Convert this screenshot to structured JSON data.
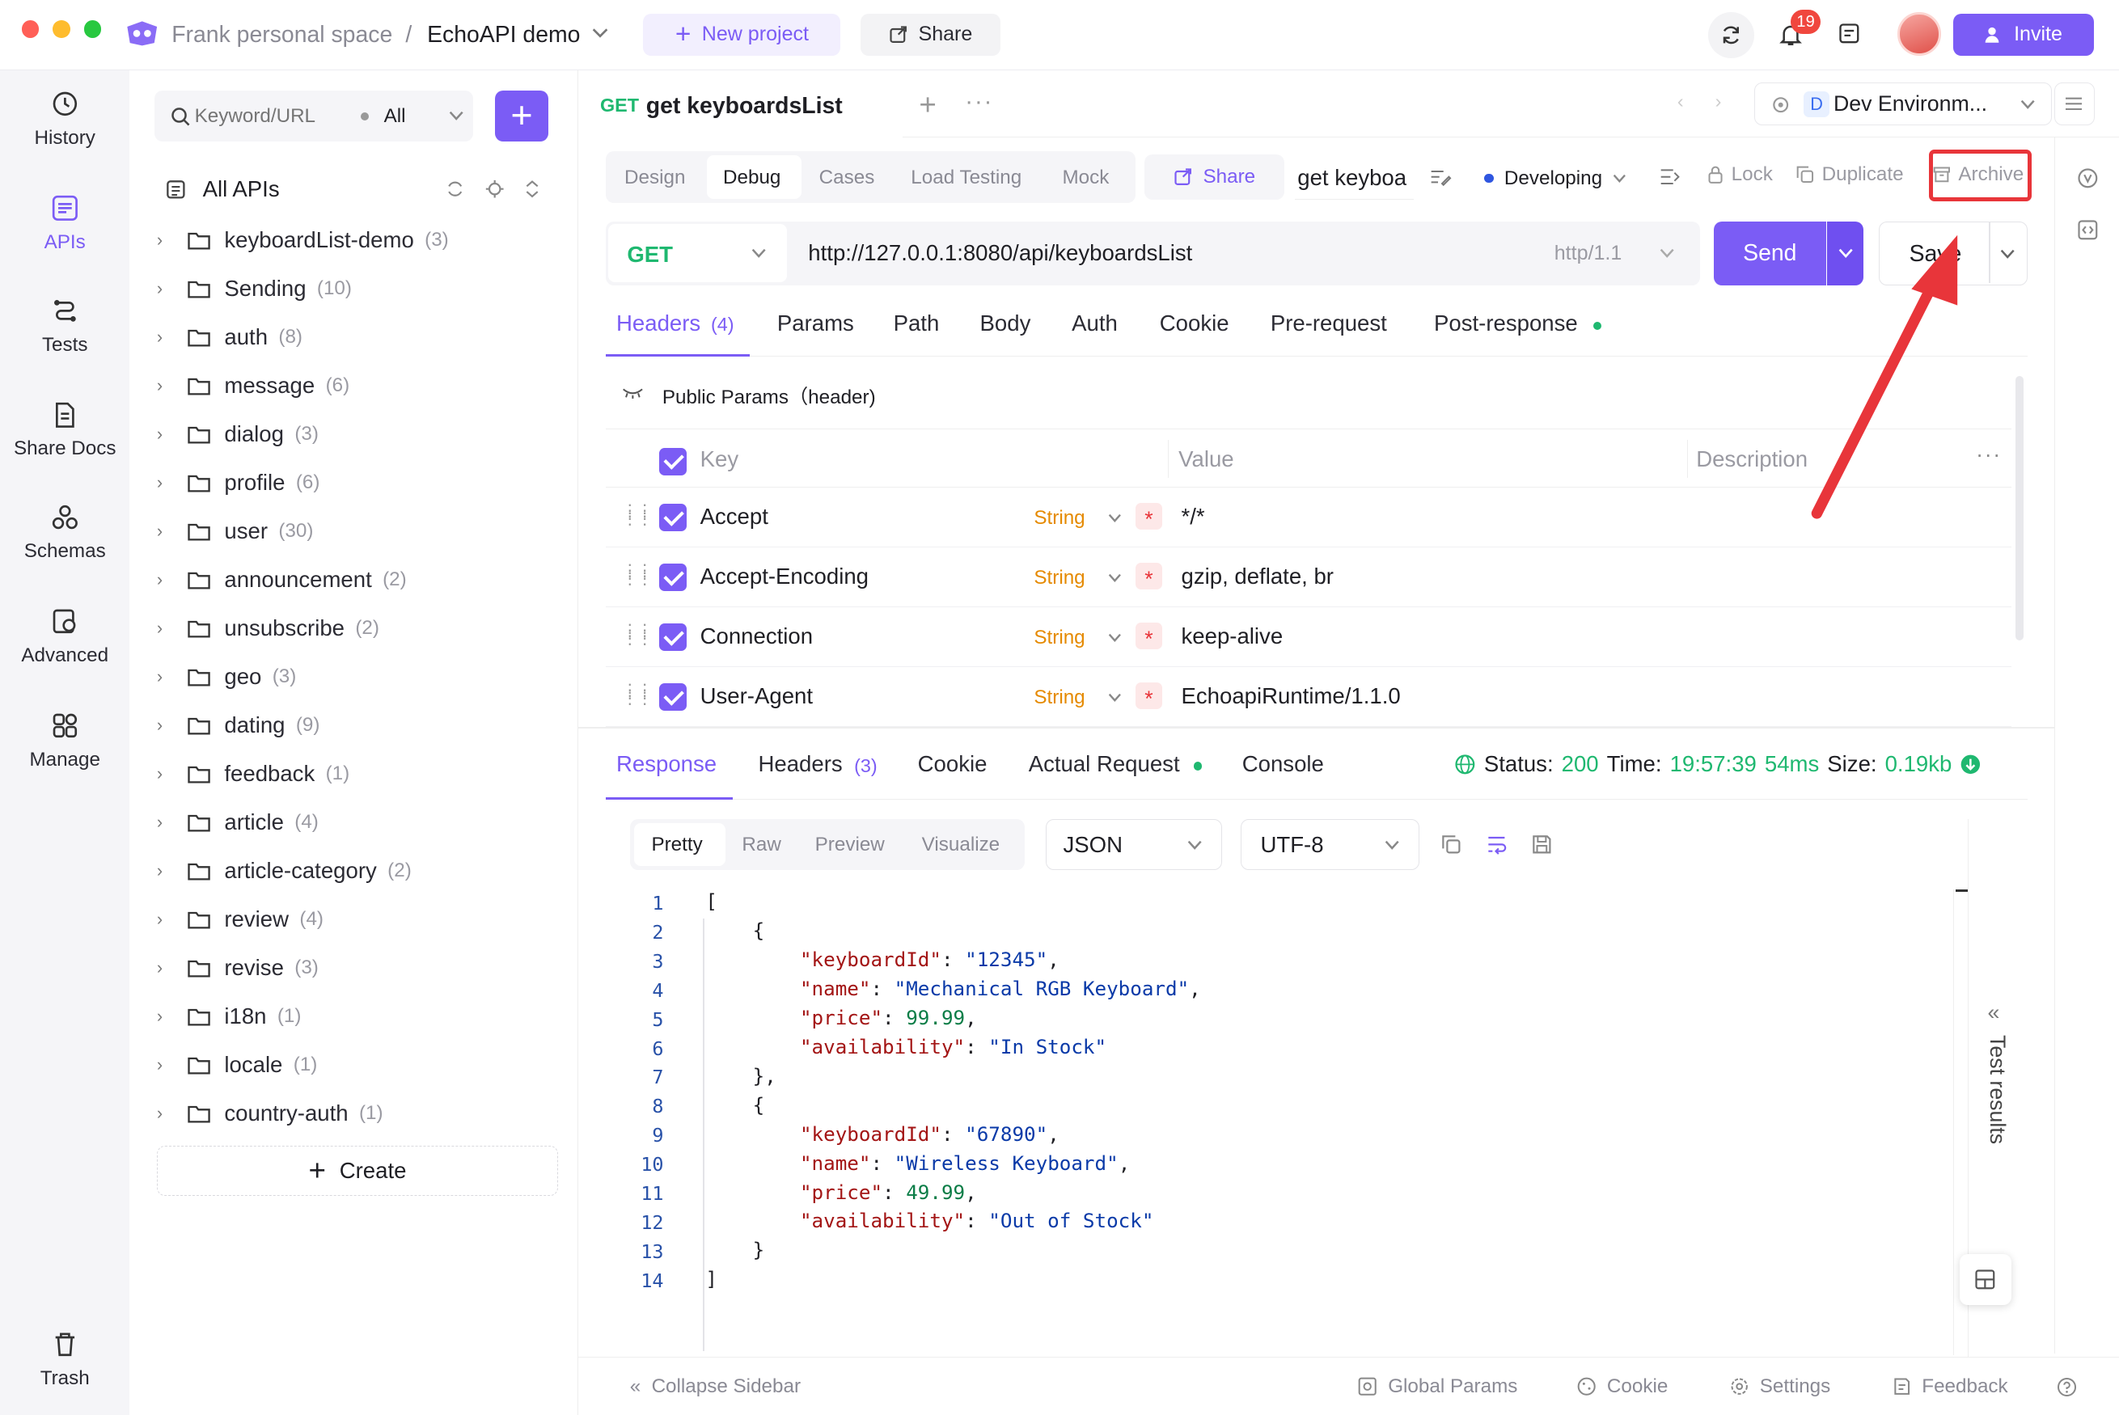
{
  "titlebar": {
    "workspace": "Frank personal space",
    "separator": "/",
    "project": "EchoAPI demo",
    "new_project": "New project",
    "share": "Share",
    "notif_count": "19",
    "invite": "Invite"
  },
  "rail": {
    "items": [
      "History",
      "APIs",
      "Tests",
      "Share Docs",
      "Schemas",
      "Advanced",
      "Manage"
    ],
    "trash": "Trash"
  },
  "tree": {
    "search_placeholder": "Keyword/URL",
    "filter": "All",
    "all_apis": "All APIs",
    "folders": [
      {
        "name": "keyboardList-demo",
        "count": "(3)"
      },
      {
        "name": "Sending",
        "count": "(10)"
      },
      {
        "name": "auth",
        "count": "(8)"
      },
      {
        "name": "message",
        "count": "(6)"
      },
      {
        "name": "dialog",
        "count": "(3)"
      },
      {
        "name": "profile",
        "count": "(6)"
      },
      {
        "name": "user",
        "count": "(30)"
      },
      {
        "name": "announcement",
        "count": "(2)"
      },
      {
        "name": "unsubscribe",
        "count": "(2)"
      },
      {
        "name": "geo",
        "count": "(3)"
      },
      {
        "name": "dating",
        "count": "(9)"
      },
      {
        "name": "feedback",
        "count": "(1)"
      },
      {
        "name": "article",
        "count": "(4)"
      },
      {
        "name": "article-category",
        "count": "(2)"
      },
      {
        "name": "review",
        "count": "(4)"
      },
      {
        "name": "revise",
        "count": "(3)"
      },
      {
        "name": "i18n",
        "count": "(1)"
      },
      {
        "name": "locale",
        "count": "(1)"
      },
      {
        "name": "country-auth",
        "count": "(1)"
      }
    ],
    "create": "Create"
  },
  "doc_tab": {
    "method": "GET",
    "name": "get keyboardsList"
  },
  "env": {
    "badge": "D",
    "name": "Dev Environm..."
  },
  "mode_tabs": [
    "Design",
    "Debug",
    "Cases",
    "Load Testing",
    "Mock"
  ],
  "toolbar": {
    "share": "Share",
    "name_field": "get keyboa",
    "status": "Developing",
    "lock": "Lock",
    "duplicate": "Duplicate",
    "archive": "Archive"
  },
  "request": {
    "method": "GET",
    "url": "http://127.0.0.1:8080/api/keyboardsList",
    "protocol": "http/1.1",
    "send": "Send",
    "save": "Save"
  },
  "req_tabs": [
    {
      "label": "Headers",
      "count": "(4)"
    },
    {
      "label": "Params"
    },
    {
      "label": "Path"
    },
    {
      "label": "Body"
    },
    {
      "label": "Auth"
    },
    {
      "label": "Cookie"
    },
    {
      "label": "Pre-request"
    },
    {
      "label": "Post-response"
    }
  ],
  "public_params": "Public Params（header)",
  "headers_table": {
    "col_key": "Key",
    "col_value": "Value",
    "col_desc": "Description",
    "rows": [
      {
        "key": "Accept",
        "type": "String",
        "value": "*/*"
      },
      {
        "key": "Accept-Encoding",
        "type": "String",
        "value": "gzip, deflate, br"
      },
      {
        "key": "Connection",
        "type": "String",
        "value": "keep-alive"
      },
      {
        "key": "User-Agent",
        "type": "String",
        "value": "EchoapiRuntime/1.1.0"
      }
    ]
  },
  "resp_tabs": [
    {
      "label": "Response"
    },
    {
      "label": "Headers",
      "count": "(3)"
    },
    {
      "label": "Cookie"
    },
    {
      "label": "Actual Request"
    },
    {
      "label": "Console"
    }
  ],
  "resp_meta": {
    "status_label": "Status:",
    "status": "200",
    "time_label": "Time:",
    "time": "19:57:39",
    "duration": "54ms",
    "size_label": "Size:",
    "size": "0.19kb"
  },
  "view_tabs": [
    "Pretty",
    "Raw",
    "Preview",
    "Visualize"
  ],
  "format": "JSON",
  "encoding": "UTF-8",
  "code_lines": [
    "[",
    "    {",
    "        \"keyboardId\": \"12345\",",
    "        \"name\": \"Mechanical RGB Keyboard\",",
    "        \"price\": 99.99,",
    "        \"availability\": \"In Stock\"",
    "    },",
    "    {",
    "        \"keyboardId\": \"67890\",",
    "        \"name\": \"Wireless Keyboard\",",
    "        \"price\": 49.99,",
    "        \"availability\": \"Out of Stock\"",
    "    }",
    "]"
  ],
  "test_results": "Test results",
  "footer": {
    "collapse": "Collapse Sidebar",
    "global": "Global Params",
    "cookie": "Cookie",
    "settings": "Settings",
    "feedback": "Feedback"
  },
  "colors": {
    "accent": "#7b5cf5",
    "success": "#1fb870",
    "warning": "#e58a00",
    "annotation": "#e8353a"
  }
}
